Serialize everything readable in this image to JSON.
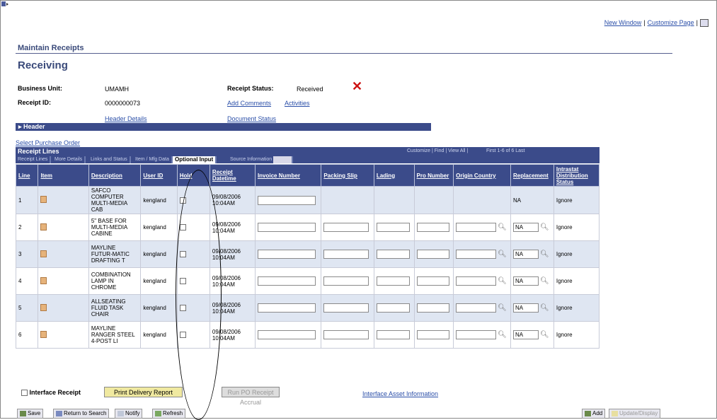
{
  "top_links": {
    "new_window": "New Window",
    "customize_page": "Customize Page"
  },
  "page": {
    "component": "Maintain Receipts",
    "title": "Receiving"
  },
  "fields": {
    "business_unit_label": "Business Unit:",
    "business_unit_value": "UMAMH",
    "receipt_id_label": "Receipt ID:",
    "receipt_id_value": "0000000073",
    "receipt_status_label": "Receipt Status:",
    "receipt_status_value": "Received"
  },
  "links": {
    "add_comments": "Add Comments",
    "activities": "Activities",
    "header_details": "Header Details",
    "document_status": "Document Status",
    "select_po": "Select Purchase Order",
    "interface_asset": "Interface Asset Information"
  },
  "header_bar": "Header",
  "receipt_lines": {
    "title": "Receipt Lines",
    "customize": "Customize | Find | View All |",
    "nav": "First  1-6 of 6  Last",
    "tabs": [
      "Receipt Lines",
      "More Details",
      "Links and Status",
      "Item / Mfg Data",
      "Optional Input",
      "Source Information"
    ],
    "active_tab": "Optional Input",
    "columns": [
      "Line",
      "Item",
      "Description",
      "User ID",
      "Hold",
      "Receipt Datetime",
      "Invoice Number",
      "Packing Slip",
      "Lading",
      "Pro Number",
      "Origin Country",
      "Replacement",
      "Intrastat Distribution Status"
    ],
    "rows": [
      {
        "line": "1",
        "description": "SAFCO COMPUTER MULTI-MEDIA CAB",
        "user": "kengland",
        "datetime": "09/08/2006 10:04AM",
        "replacement": "NA",
        "intrastat": "Ignore"
      },
      {
        "line": "2",
        "description": "5\" BASE FOR MULTI-MEDIA CABINE",
        "user": "kengland",
        "datetime": "09/08/2006 10:04AM",
        "replacement": "NA",
        "intrastat": "Ignore"
      },
      {
        "line": "3",
        "description": "MAYLINE FUTUR-MATIC DRAFTING T",
        "user": "kengland",
        "datetime": "09/08/2006 10:04AM",
        "replacement": "NA",
        "intrastat": "Ignore"
      },
      {
        "line": "4",
        "description": "COMBINATION LAMP IN CHROME",
        "user": "kengland",
        "datetime": "09/08/2006 10:04AM",
        "replacement": "NA",
        "intrastat": "Ignore"
      },
      {
        "line": "5",
        "description": "ALLSEATING FLUID TASK CHAIR",
        "user": "kengland",
        "datetime": "09/08/2006 10:04AM",
        "replacement": "NA",
        "intrastat": "Ignore"
      },
      {
        "line": "6",
        "description": "MAYLINE RANGER STEEL 4-POST LI",
        "user": "kengland",
        "datetime": "09/08/2006 10:04AM",
        "replacement": "NA",
        "intrastat": "Ignore"
      }
    ]
  },
  "bottom": {
    "interface_receipt": "Interface Receipt",
    "print_delivery": "Print Delivery Report",
    "run_accrual": "Run PO Receipt Accrual"
  },
  "toolbar": {
    "save": "Save",
    "return": "Return to Search",
    "notify": "Notify",
    "refresh": "Refresh",
    "add": "Add",
    "update": "Update/Display"
  }
}
